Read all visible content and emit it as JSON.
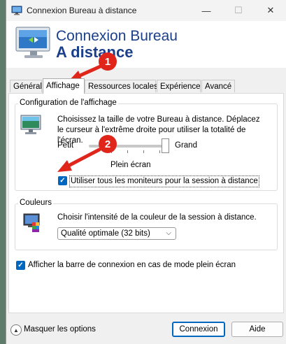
{
  "window": {
    "title": "Connexion Bureau à distance",
    "minimize": "—",
    "maximize": "☐",
    "close": "✕"
  },
  "header": {
    "line1": "Connexion Bureau",
    "line2": "A distance"
  },
  "tabs": [
    {
      "label": "Général",
      "active": false
    },
    {
      "label": "Affichage",
      "active": true
    },
    {
      "label": "Ressources locales",
      "active": false
    },
    {
      "label": "Expérience",
      "active": false
    },
    {
      "label": "Avancé",
      "active": false
    }
  ],
  "display_group": {
    "legend": "Configuration de l'affichage",
    "description": "Choisissez la taille de votre Bureau à distance. Déplacez le curseur à l'extrême droite pour utiliser la totalité de l'écran.",
    "slider_min_label": "Petit",
    "slider_max_label": "Grand",
    "slider_value_label": "Plein écran",
    "slider_position": 1.0,
    "multi_monitor_label": "Utiliser tous les moniteurs pour la session à distance",
    "multi_monitor_checked": true
  },
  "colors_group": {
    "legend": "Couleurs",
    "description": "Choisir l'intensité de la couleur de la session à distance.",
    "selected": "Qualité optimale (32 bits)"
  },
  "bar_checkbox": {
    "label": "Afficher la barre de connexion en cas de mode plein écran",
    "checked": true
  },
  "footer": {
    "hide_options": "Masquer les options",
    "connect": "Connexion",
    "help": "Aide"
  },
  "annotations": {
    "badge1": "1",
    "badge2": "2"
  },
  "colors": {
    "accent": "#0067c0",
    "annotation_red": "#e0251b",
    "title_blue": "#1b3f8b"
  }
}
